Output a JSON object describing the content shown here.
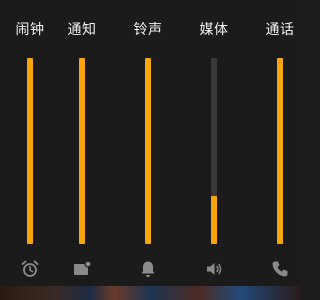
{
  "colors": {
    "background": "#1b1b1b",
    "track": "#3a3a3a",
    "fill": "#f7a60c",
    "icon": "#8a8a8a",
    "label": "#f2f2f2"
  },
  "streams": [
    {
      "label": "闹钟",
      "icon": "alarm-clock-icon",
      "level": 1.0
    },
    {
      "label": "通知",
      "icon": "notification-icon",
      "level": 1.0
    },
    {
      "label": "铃声",
      "icon": "bell-icon",
      "level": 1.0
    },
    {
      "label": "媒体",
      "icon": "speaker-icon",
      "level": 0.26
    },
    {
      "label": "通话",
      "icon": "phone-icon",
      "level": 1.0
    }
  ]
}
